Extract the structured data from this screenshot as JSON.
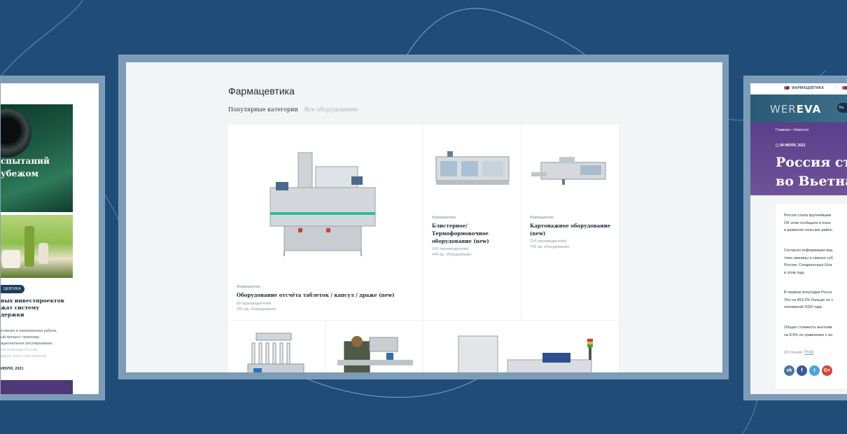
{
  "main": {
    "page_title": "Фармацевтика",
    "tabs": [
      {
        "label": "Популярные категории",
        "active": true
      },
      {
        "label": "Все оборудование",
        "active": false
      }
    ],
    "cards": [
      {
        "category": "Фармацевтика",
        "title": "Оборудование отсчёта таблеток / капсул / драже (new)",
        "producers": "69 производителей",
        "equipment": "201 ед. оборудования"
      },
      {
        "category": "Фармацевтика",
        "title_lines": [
          "Блистерное/",
          "Термоформовочное",
          "оборудование (new)"
        ],
        "producers": "109 производителей",
        "equipment": "444 ед. оборудования"
      },
      {
        "category": "Фармацевтика",
        "title_lines": [
          "Картонажное оборудование",
          "(new)"
        ],
        "producers": "214 производителей",
        "equipment": "758 ед. оборудования"
      }
    ]
  },
  "left_preview": {
    "hero_lines": [
      "спытаний",
      "убежом"
    ],
    "badge": "ЦЕВТИКА",
    "title_lines": [
      "вых инвестпроектов",
      "жат систему",
      "держки"
    ],
    "body_lines": [
      "ктивная и напряженная работа,",
      "ый процесс перехода",
      "ациональное регулирование,",
      "ый переезда Россия,",
      "дания этого года переход"
    ],
    "date": "ИЮЛЯ, 2021"
  },
  "right_preview": {
    "top_label_1": "ФАРМАЦЕВТИКА",
    "logo_a": "WER",
    "logo_b": "EVA",
    "lang": "Ru",
    "breadcrumb": "Главная  ›  Новости",
    "date": "09 ИЮЛЯ, 2021",
    "heading_lines": [
      "Россия ста",
      "во Вьетнам"
    ],
    "paragraphs": [
      [
        "Россия стала крупнейшим",
        "Об этом сообщила в поне",
        "и развития сельских район"
      ],
      [
        "Согласно информации вед",
        "тонн свинины и свиных суб",
        "Россия, Соединенные Шта",
        "в этом году."
      ],
      [
        "В первом полугодии Росси",
        "Это на 493,2% больше по с",
        "половиной 2020 года."
      ],
      [
        "Общая стоимость вьетнам",
        "на 8,9% по сравнению с ан"
      ]
    ],
    "source_label": "Источник:",
    "source_link": "FNW",
    "social": [
      "vk",
      "f",
      "t",
      "G+"
    ]
  }
}
